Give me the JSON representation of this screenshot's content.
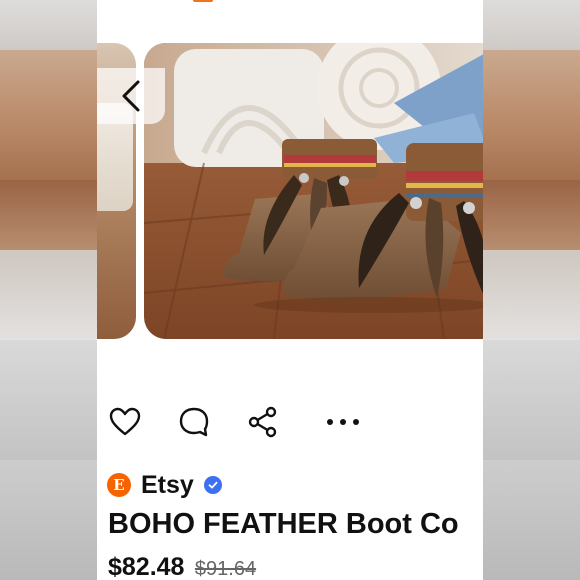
{
  "listing": {
    "shop_logo_letter": "E",
    "shop_name": "Etsy",
    "title": "BOHO FEATHER Boot Co",
    "price": "$82.48",
    "original_price": "$91.64"
  },
  "icons": {
    "back": "chevron-left-icon",
    "like": "heart-icon",
    "comment": "comment-bubble-icon",
    "share": "share-icon",
    "more": "more-dots-icon",
    "verified": "verified-check-icon"
  },
  "colors": {
    "etsy_orange": "#f56400",
    "verified_blue": "#3d6ff2",
    "text_primary": "#111111",
    "text_muted": "#666666"
  }
}
